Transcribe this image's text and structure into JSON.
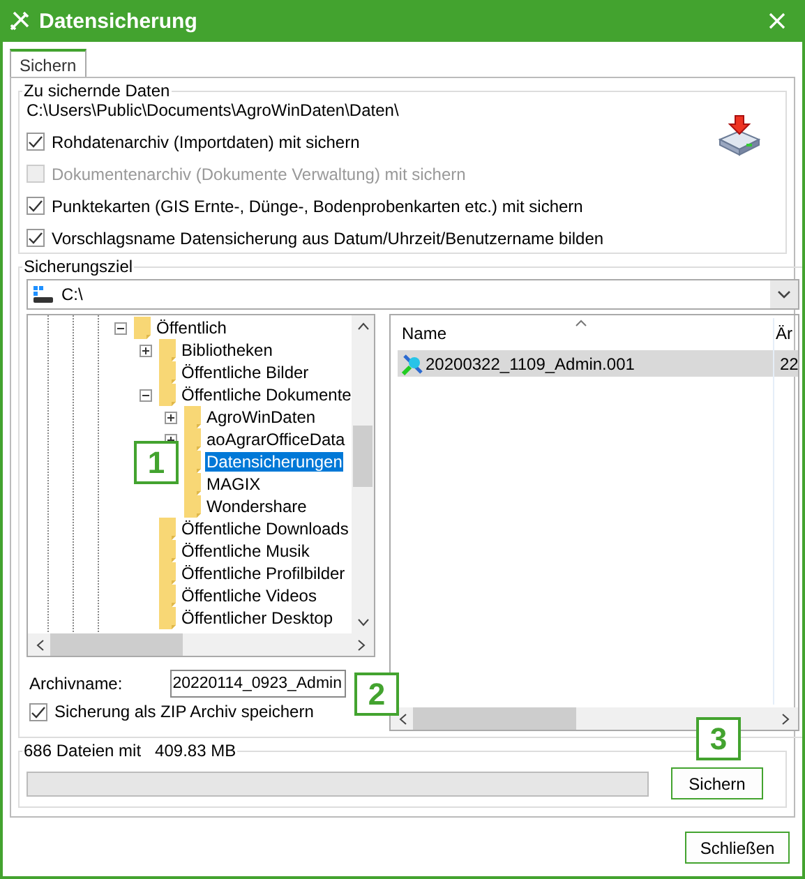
{
  "window": {
    "title": "Datensicherung"
  },
  "tabs": [
    {
      "label": "Sichern",
      "selected": true
    }
  ],
  "source_group": {
    "title": "Zu sichernde Daten",
    "path": "C:\\Users\\Public\\Documents\\AgroWinDaten\\Daten\\",
    "options": [
      {
        "label": "Rohdatenarchiv (Importdaten) mit sichern",
        "checked": true,
        "disabled": false
      },
      {
        "label": "Dokumentenarchiv (Dokumente Verwaltung) mit sichern",
        "checked": false,
        "disabled": true
      },
      {
        "label": "Punktekarten (GIS Ernte-, Dünge-, Bodenprobenkarten etc.) mit sichern",
        "checked": true,
        "disabled": false
      },
      {
        "label": "Vorschlagsname Datensicherung aus Datum/Uhrzeit/Benutzername bilden",
        "checked": true,
        "disabled": false
      }
    ]
  },
  "target_group": {
    "title": "Sicherungsziel",
    "drive": "C:\\",
    "folder_tree": [
      {
        "label": "Öffentlich",
        "expanded": true,
        "selected": false,
        "children": [
          {
            "label": "Bibliotheken",
            "expanded": false,
            "selected": false
          },
          {
            "label": "Öffentliche Bilder",
            "selected": false
          },
          {
            "label": "Öffentliche Dokumente",
            "expanded": true,
            "selected": false,
            "children": [
              {
                "label": "AgroWinDaten",
                "expanded": false,
                "selected": false
              },
              {
                "label": "aoAgrarOfficeData",
                "expanded": false,
                "selected": false
              },
              {
                "label": "Datensicherungen",
                "selected": true
              },
              {
                "label": "MAGIX",
                "selected": false
              },
              {
                "label": "Wondershare",
                "selected": false
              }
            ]
          },
          {
            "label": "Öffentliche Downloads",
            "selected": false
          },
          {
            "label": "Öffentliche Musik",
            "selected": false
          },
          {
            "label": "Öffentliche Profilbilder",
            "selected": false
          },
          {
            "label": "Öffentliche Videos",
            "selected": false
          },
          {
            "label": "Öffentlicher Desktop",
            "selected": false
          }
        ]
      }
    ],
    "file_list": {
      "columns": [
        "Name",
        "Är"
      ],
      "rows": [
        {
          "cells": [
            "20200322_1109_Admin.001",
            "22"
          ],
          "selected": true
        }
      ]
    },
    "archive_name": {
      "label": "Archivname:",
      "value": "20220114_0923_Admin"
    },
    "zip_option": {
      "label": "Sicherung als ZIP Archiv speichern",
      "checked": true
    }
  },
  "status_group": {
    "file_count": "686 Dateien mit",
    "size": "409.83 MB",
    "progress": {
      "level": 0
    },
    "save_button": "Sichern"
  },
  "close_button": "Schließen",
  "callouts": [
    "1",
    "2",
    "3"
  ]
}
